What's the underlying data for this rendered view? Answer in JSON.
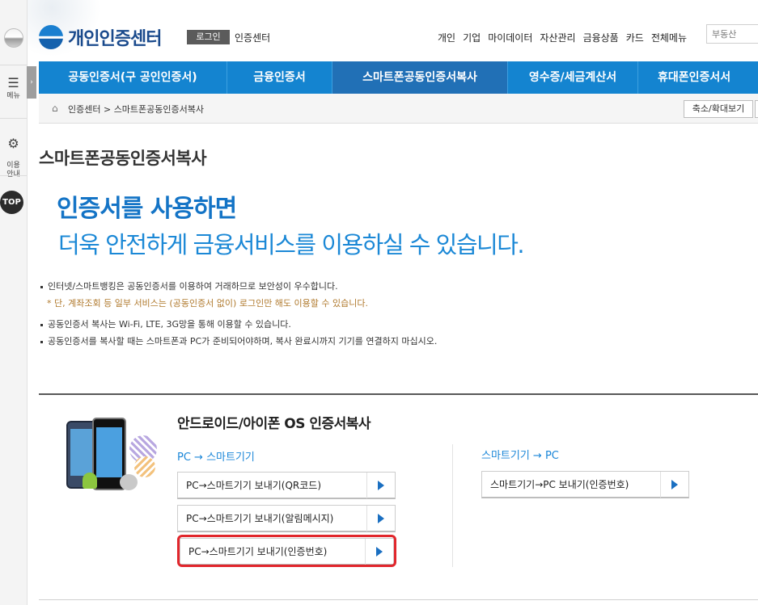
{
  "rail": {
    "menu_label": "메뉴",
    "guide_label": "이용\n안내",
    "top_label": "TOP"
  },
  "header": {
    "logo_text": "개인인증센터",
    "login_label": "로그인",
    "center_label": "인증센터",
    "topnav": [
      "개인",
      "기업",
      "마이데이터",
      "자산관리",
      "금융상품",
      "카드",
      "전체메뉴"
    ],
    "search_placeholder": "부동산"
  },
  "mainnav": [
    {
      "label": "공동인증서(구 공인인증서)",
      "active": false
    },
    {
      "label": "금융인증서",
      "active": false
    },
    {
      "label": "스마트폰공동인증서복사",
      "active": true
    },
    {
      "label": "영수증/세금계산서",
      "active": false
    },
    {
      "label": "휴대폰인증서서",
      "active": false
    }
  ],
  "breadcrumb": {
    "path": "인증센터 > 스마트폰공동인증서복사",
    "zoom_label": "축소/확대보기"
  },
  "content": {
    "page_title": "스마트폰공동인증서복사",
    "hero_line1": "인증서를 사용하면",
    "hero_line2": "더욱 안전하게 금융서비스를 이용하실 수 있습니다.",
    "bullets": [
      "인터넷/스마트뱅킹은 공동인증서를 이용하여 거래하므로 보안성이 우수합니다.",
      "* 단, 계좌조회 등 일부 서비스는 (공동인증서 없이) 로그인만 해도 이용할 수 있습니다.",
      "공동인증서 복사는 Wi-Fi, LTE, 3G망을 통해 이용할 수 있습니다.",
      "공동인증서를 복사할 때는 스마트폰과 PC가 준비되어야하며, 복사 완료시까지 기기를 연결하지 마십시오."
    ]
  },
  "section": {
    "title": "안드로이드/아이폰 OS 인증서복사",
    "left_title": "PC → 스마트기기",
    "right_title": "스마트기기 → PC",
    "left_buttons": [
      "PC→스마트기기 보내기(QR코드)",
      "PC→스마트기기 보내기(알림메시지)",
      "PC→스마트기기 보내기(인증번호)"
    ],
    "right_buttons": [
      "스마트기기→PC 보내기(인증번호)"
    ]
  },
  "colors": {
    "nav_blue": "#1484d0",
    "nav_active": "#2170b6",
    "hero_blue": "#1474c6",
    "highlight_red": "#e1262c"
  }
}
